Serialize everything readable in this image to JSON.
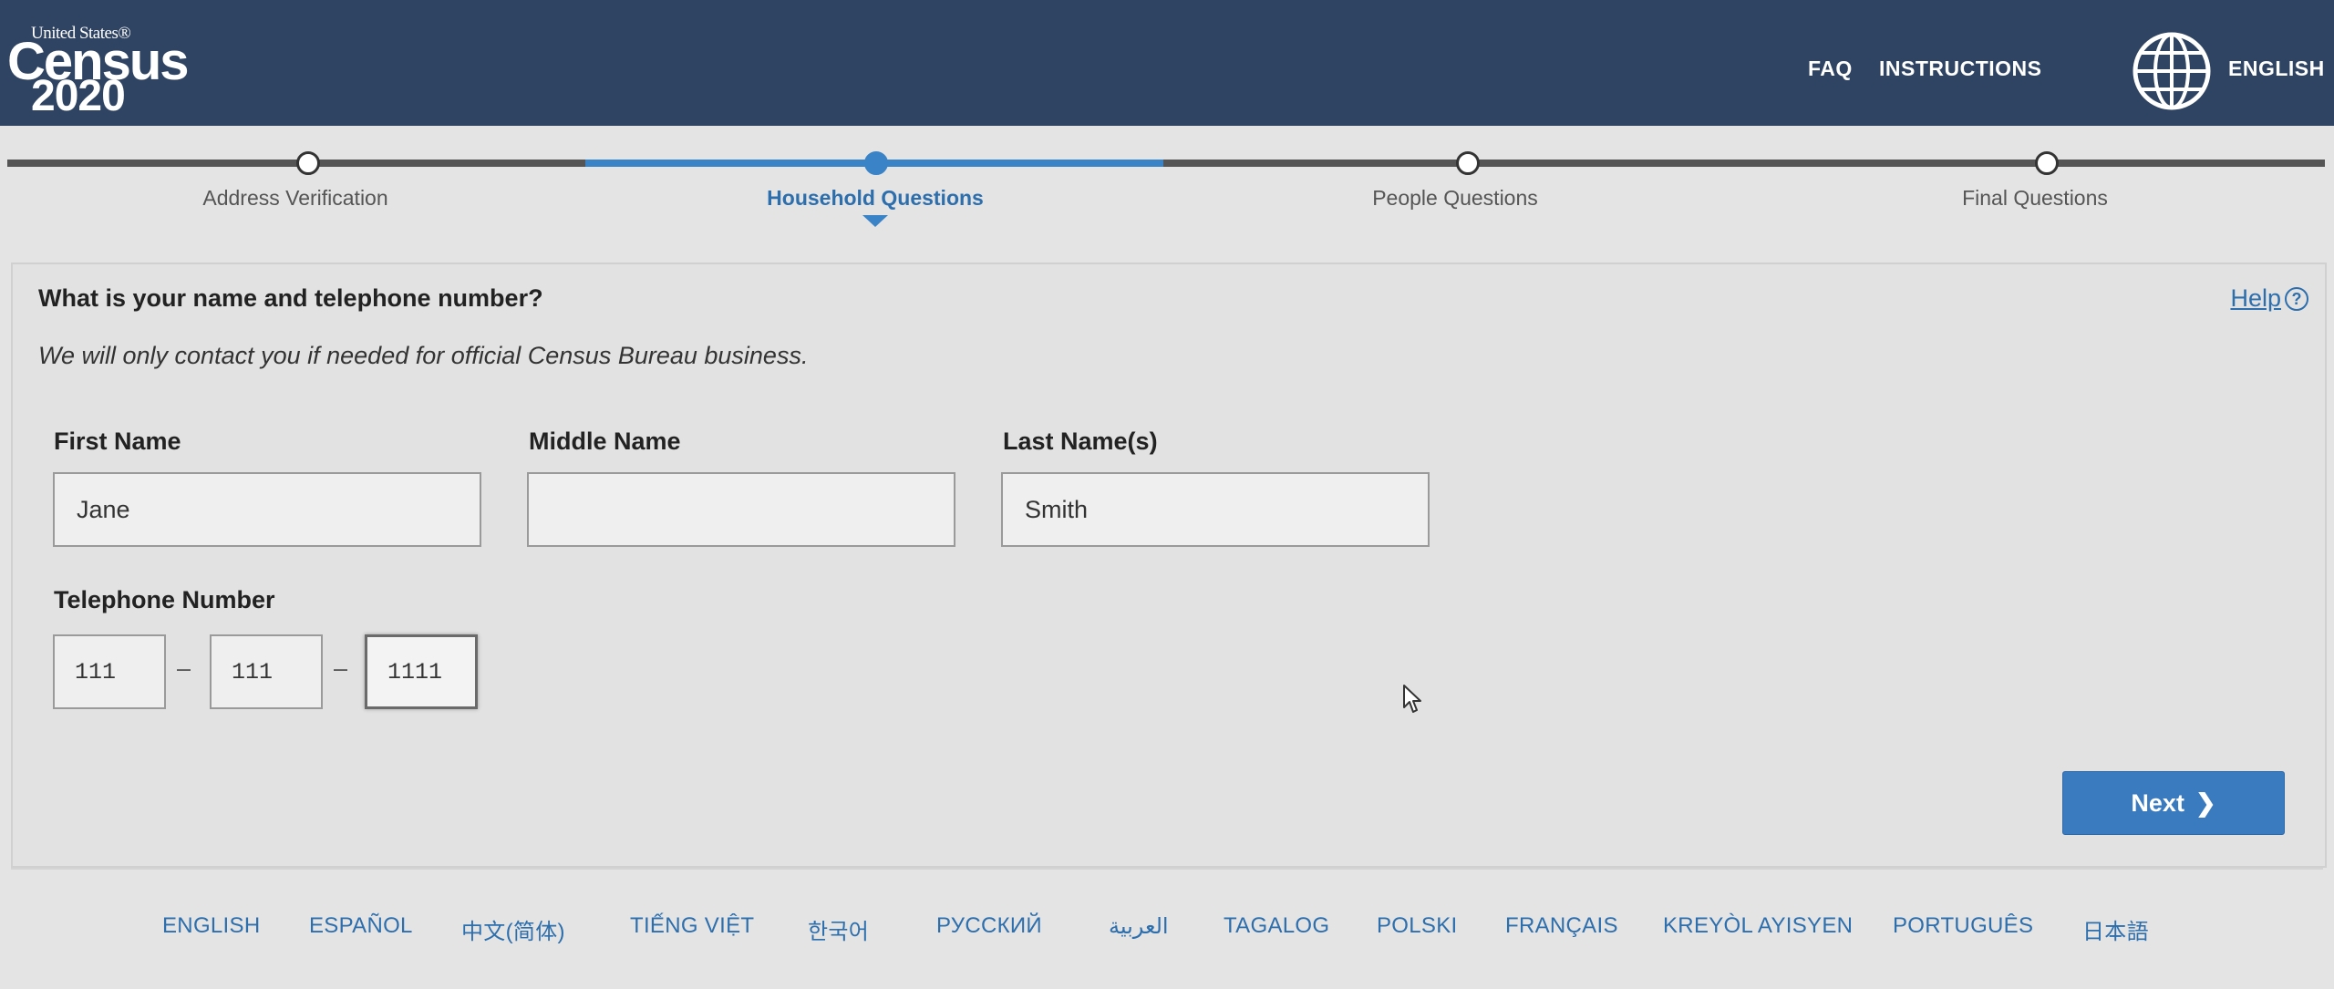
{
  "header": {
    "logo_small": "United States®",
    "logo_big": "Census",
    "logo_year": "2020",
    "faq": "FAQ",
    "instructions": "INSTRUCTIONS",
    "language": "ENGLISH"
  },
  "progress": {
    "steps": [
      {
        "label": "Address Verification",
        "state": "done"
      },
      {
        "label": "Household Questions",
        "state": "current"
      },
      {
        "label": "People Questions",
        "state": "upcoming"
      },
      {
        "label": "Final Questions",
        "state": "upcoming"
      }
    ]
  },
  "form": {
    "title": "What is your name and telephone number?",
    "subtitle": "We will only contact you if needed for official Census Bureau business.",
    "help": "Help",
    "help_icon": "?",
    "first_name_label": "First Name",
    "first_name_value": "Jane",
    "middle_name_label": "Middle Name",
    "middle_name_value": "",
    "last_name_label": "Last Name(s)",
    "last_name_value": "Smith",
    "phone_label": "Telephone Number",
    "phone_area": "111",
    "phone_prefix": "111",
    "phone_line": "1111",
    "dash": "–",
    "next": "Next",
    "next_icon": "❯"
  },
  "footer": {
    "languages": [
      "ENGLISH",
      "ESPAÑOL",
      "中文(简体)",
      "TIẾNG VIỆT",
      "한국어",
      "РУССКИЙ",
      "العربية",
      "TAGALOG",
      "POLSKI",
      "FRANÇAIS",
      "KREYÒL AYISYEN",
      "PORTUGUÊS",
      "日本語"
    ]
  },
  "colors": {
    "header_bg": "#2f4462",
    "accent": "#3a83c7",
    "link": "#2d6ead"
  },
  "icons": {
    "globe": "globe-icon",
    "help": "help-circle-icon",
    "next": "chevron-right-icon",
    "cursor": "mouse-pointer-icon"
  }
}
